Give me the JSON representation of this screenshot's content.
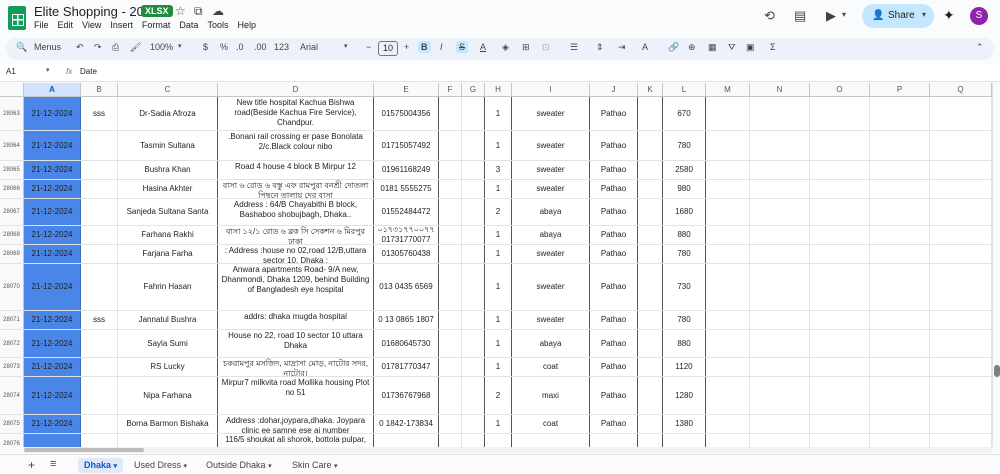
{
  "app": {
    "title": "Elite Shopping - 2024",
    "badge": "XLSX",
    "share_label": "Share",
    "avatar": "S"
  },
  "menu": [
    "File",
    "Edit",
    "View",
    "Insert",
    "Format",
    "Data",
    "Tools",
    "Help"
  ],
  "toolbar": {
    "search_label": "Menus",
    "zoom": "100%",
    "currency": "$",
    "percent": "%",
    "dec_less": ".0",
    "dec_more": ".00",
    "number_format": "123",
    "font": "Arial",
    "font_size": "10",
    "bold": "B",
    "italic": "I",
    "strike": "S",
    "text_color": "A",
    "minus": "−",
    "plus": "+",
    "functions": "Σ"
  },
  "formula_bar": {
    "cell_ref": "A1",
    "fx": "fx",
    "value": "Date"
  },
  "columns": [
    "A",
    "B",
    "C",
    "D",
    "E",
    "F",
    "G",
    "H",
    "I",
    "J",
    "K",
    "L",
    "M",
    "N",
    "O",
    "P",
    "Q"
  ],
  "rows": [
    {
      "num": "28063",
      "date": "21-12-2024",
      "b": "sss",
      "name": "Dr-Sadia Afroza",
      "addr": "New title hospital Kachua Bishwa road(Beside Kachua Fire Service), Chandpur.",
      "phone": "01575004356",
      "qty": "1",
      "item": "sweater",
      "courier": "Pathao",
      "price": "670"
    },
    {
      "num": "28064",
      "date": "21-12-2024",
      "b": "",
      "name": "Tasmin Sultana",
      "addr": ".Bonani rail crossing er pase Bonolata 2/c.Black colour nibo",
      "phone": "01715057492",
      "qty": "1",
      "item": "sweater",
      "courier": "Pathao",
      "price": "780"
    },
    {
      "num": "28065",
      "date": "21-12-2024",
      "b": "",
      "name": "Bushra Khan",
      "addr": "Road 4 house 4 block B Mirpur 12",
      "phone": "01961168249",
      "qty": "3",
      "item": "sweater",
      "courier": "Pathao",
      "price": "2580"
    },
    {
      "num": "28066",
      "date": "21-12-2024",
      "b": "",
      "name": "Hasina Akhter",
      "addr": "বাসা ৬ রোড ৬ বস্তু এফ রামপুরা বনশ্রী দোতলা পিছনে তালায় দের বাসা",
      "phone": "0181 5555275",
      "qty": "1",
      "item": "sweater",
      "courier": "Pathao",
      "price": "980"
    },
    {
      "num": "28067",
      "date": "21-12-2024",
      "b": "",
      "name": "Sanjeda Sultana Santa",
      "addr": "Address : 64/B Chayabithi B block, Bashaboo shobujbagh, Dhaka..",
      "phone": "01552484472",
      "qty": "2",
      "item": "abaya",
      "courier": "Pathao",
      "price": "1680"
    },
    {
      "num": "28068",
      "date": "21-12-2024",
      "b": "",
      "name": "Farhana Rakhi",
      "addr": "বাসা ১২/১ রোড ৬ ব্লক সি সেকশন ৬ মিরপুর ঢাকা",
      "phone": "০১৭৩১৭৭০০৭৭ 01731770077",
      "qty": "1",
      "item": "abaya",
      "courier": "Pathao",
      "price": "880"
    },
    {
      "num": "28069",
      "date": "21-12-2024",
      "b": "",
      "name": "Farjana Farha",
      "addr": ": Address :house no 02,road 12/B,uttara sector 10, Dhaka :",
      "phone": "01305760438",
      "qty": "1",
      "item": "sweater",
      "courier": "Pathao",
      "price": "780"
    },
    {
      "num": "28070",
      "date": "21-12-2024",
      "b": "",
      "name": "Fahrin Hasan",
      "addr": "Anwara apartments Road- 9/A new, Dhanmondi, Dhaka 1209, behind Building of Bangladesh eye hospital",
      "phone": "013 0435 6569",
      "qty": "1",
      "item": "sweater",
      "courier": "Pathao",
      "price": "730"
    },
    {
      "num": "28071",
      "date": "21-12-2024",
      "b": "sss",
      "name": "Jannatul Bushra",
      "addr": "addrs: dhaka mugda hospital",
      "phone": "0 13 0865 1807",
      "qty": "1",
      "item": "sweater",
      "courier": "Pathao",
      "price": "780"
    },
    {
      "num": "28072",
      "date": "21-12-2024",
      "b": "",
      "name": "Sayla Sumi",
      "addr": "House no 22, road 10 sector 10 uttara Dhaka",
      "phone": "01680645730",
      "qty": "1",
      "item": "abaya",
      "courier": "Pathao",
      "price": "880"
    },
    {
      "num": "28073",
      "date": "21-12-2024",
      "b": "",
      "name": "RS Lucky",
      "addr": "চকরামপুর মসজিদ, মাদ্রাসা মোড়, নাটোর সদর, নাটোর।",
      "phone": "01781770347",
      "qty": "1",
      "item": "coat",
      "courier": "Pathao",
      "price": "1120"
    },
    {
      "num": "28074",
      "date": "21-12-2024",
      "b": "",
      "name": "Nipa Farhana",
      "addr": "Mirpur7 milkvita road Mollika housing Plot no 51",
      "phone": "01736767968",
      "qty": "2",
      "item": "maxi",
      "courier": "Pathao",
      "price": "1280"
    },
    {
      "num": "28075",
      "date": "21-12-2024",
      "b": "",
      "name": "Borna Barmon Bishaka",
      "addr": "Address :dohar,joypara,dhaka. Joypara clinic ee samne ese ai number",
      "phone": "0 1842-173834",
      "qty": "1",
      "item": "coat",
      "courier": "Pathao",
      "price": "1380"
    },
    {
      "num": "28076",
      "date": "",
      "b": "",
      "name": "",
      "addr": "116/5 shoukat ali shorok, bottola pulpar,",
      "phone": "",
      "qty": "",
      "item": "",
      "courier": "",
      "price": ""
    }
  ],
  "tabs": [
    "Dhaka",
    "Used Dress",
    "Outside Dhaka",
    "Skin Care"
  ]
}
